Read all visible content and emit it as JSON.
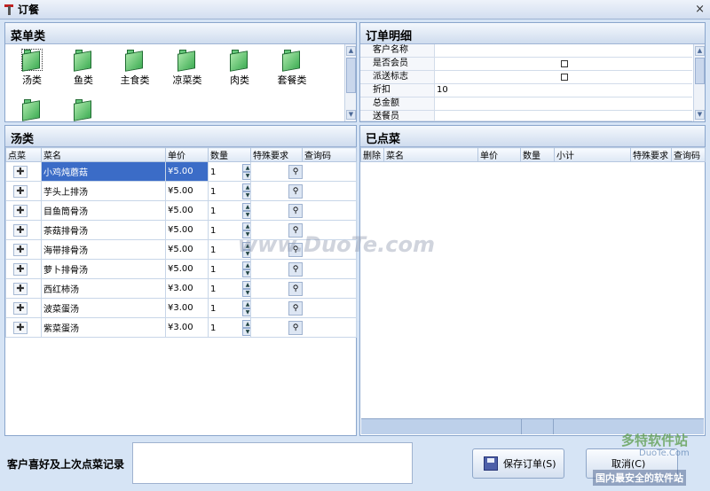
{
  "window": {
    "title": "订餐",
    "close_label": "×"
  },
  "menu_category": {
    "title": "菜单类",
    "items": [
      {
        "label": "汤类",
        "selected": true
      },
      {
        "label": "鱼类"
      },
      {
        "label": "主食类"
      },
      {
        "label": "凉菜类"
      },
      {
        "label": "肉类"
      },
      {
        "label": "套餐类"
      },
      {
        "label": ""
      },
      {
        "label": ""
      }
    ]
  },
  "dish_panel": {
    "title": "汤类",
    "columns": [
      "点菜",
      "菜名",
      "单价",
      "数量",
      "特殊要求",
      "查询码"
    ],
    "rows": [
      {
        "name": "小鸡炖蘑菇",
        "price": "¥5.00",
        "qty": "1"
      },
      {
        "name": "芋头上排汤",
        "price": "¥5.00",
        "qty": "1"
      },
      {
        "name": "目鱼筒骨汤",
        "price": "¥5.00",
        "qty": "1"
      },
      {
        "name": "茶菇排骨汤",
        "price": "¥5.00",
        "qty": "1"
      },
      {
        "name": "海带排骨汤",
        "price": "¥5.00",
        "qty": "1"
      },
      {
        "name": "萝卜排骨汤",
        "price": "¥5.00",
        "qty": "1"
      },
      {
        "name": "西红柿汤",
        "price": "¥3.00",
        "qty": "1"
      },
      {
        "name": "波菜蛋汤",
        "price": "¥3.00",
        "qty": "1"
      },
      {
        "name": "紫菜蛋汤",
        "price": "¥3.00",
        "qty": "1"
      }
    ]
  },
  "order_detail": {
    "title": "订单明细",
    "fields": [
      {
        "label": "客户名称",
        "value": ""
      },
      {
        "label": "是否会员",
        "value": "",
        "checkbox": true
      },
      {
        "label": "派送标志",
        "value": "",
        "checkbox": true
      },
      {
        "label": "折扣",
        "value": "10"
      },
      {
        "label": "总金额",
        "value": ""
      },
      {
        "label": "送餐员",
        "value": ""
      }
    ]
  },
  "ordered": {
    "title": "已点菜",
    "columns": [
      "删除",
      "菜名",
      "单价",
      "数量",
      "小计",
      "特殊要求",
      "查询码"
    ]
  },
  "footer": {
    "history_label": "客户喜好及上次点菜记录",
    "save_button": "保存订单(S)",
    "cancel_button": "取消(C)"
  },
  "watermarks": [
    "www.DuoTe.com",
    "多特软件站",
    "DuoTe.Com",
    "国内最安全的软件站"
  ]
}
